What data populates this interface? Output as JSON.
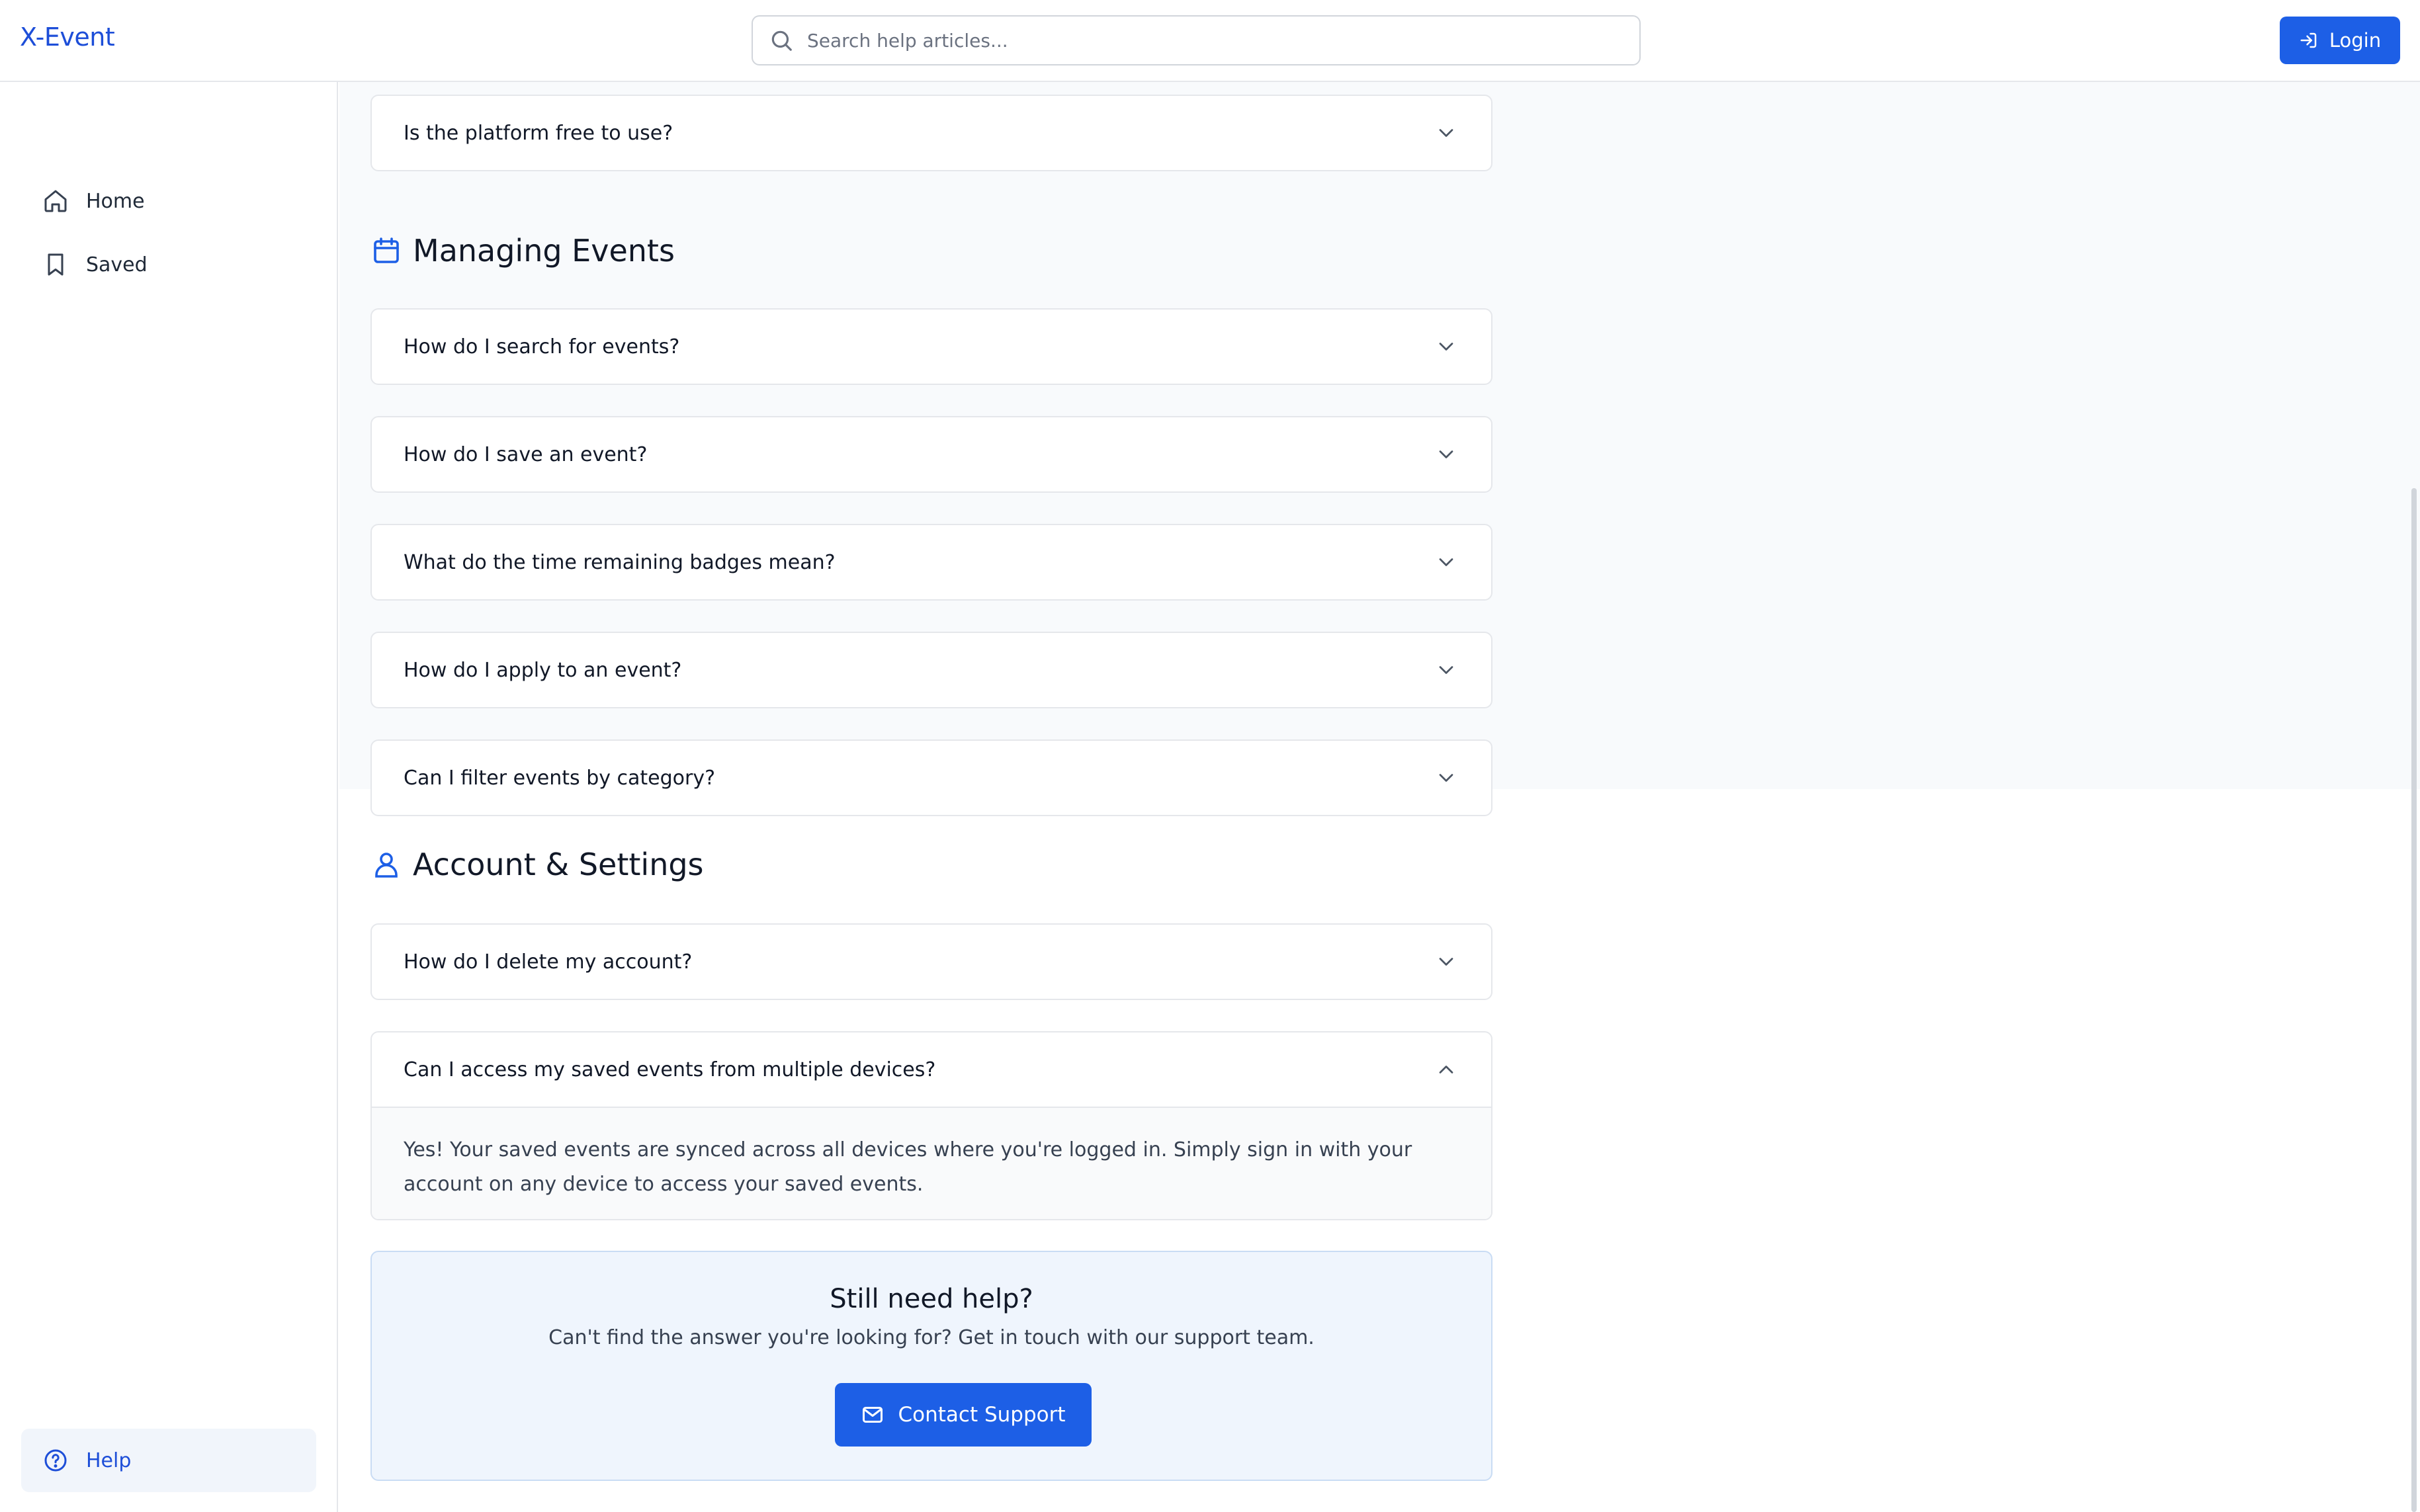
{
  "header": {
    "brand": "X-Event",
    "search_placeholder": "Search help articles...",
    "login_label": "Login"
  },
  "sidebar": {
    "items": [
      {
        "label": "Home",
        "icon": "home-icon"
      },
      {
        "label": "Saved",
        "icon": "bookmark-icon"
      }
    ],
    "help_label": "Help"
  },
  "faq_top": {
    "question": "Is the platform free to use?"
  },
  "sections": [
    {
      "title": "Managing Events",
      "icon": "calendar-icon",
      "questions": [
        "How do I search for events?",
        "How do I save an event?",
        "What do the time remaining badges mean?",
        "How do I apply to an event?",
        "Can I filter events by category?"
      ]
    },
    {
      "title": "Account & Settings",
      "icon": "user-icon",
      "questions": [
        "How do I delete my account?"
      ],
      "open_question": {
        "question": "Can I access my saved events from multiple devices?",
        "answer": "Yes! Your saved events are synced across all devices where you're logged in. Simply sign in with your account on any device to access your saved events."
      }
    }
  ],
  "help_card": {
    "title": "Still need help?",
    "subtitle": "Can't find the answer you're looking for? Get in touch with our support team.",
    "button_label": "Contact Support"
  },
  "colors": {
    "accent": "#1d5fe6",
    "brand": "#1d4ed8",
    "help_card_bg": "#eff5fd"
  }
}
